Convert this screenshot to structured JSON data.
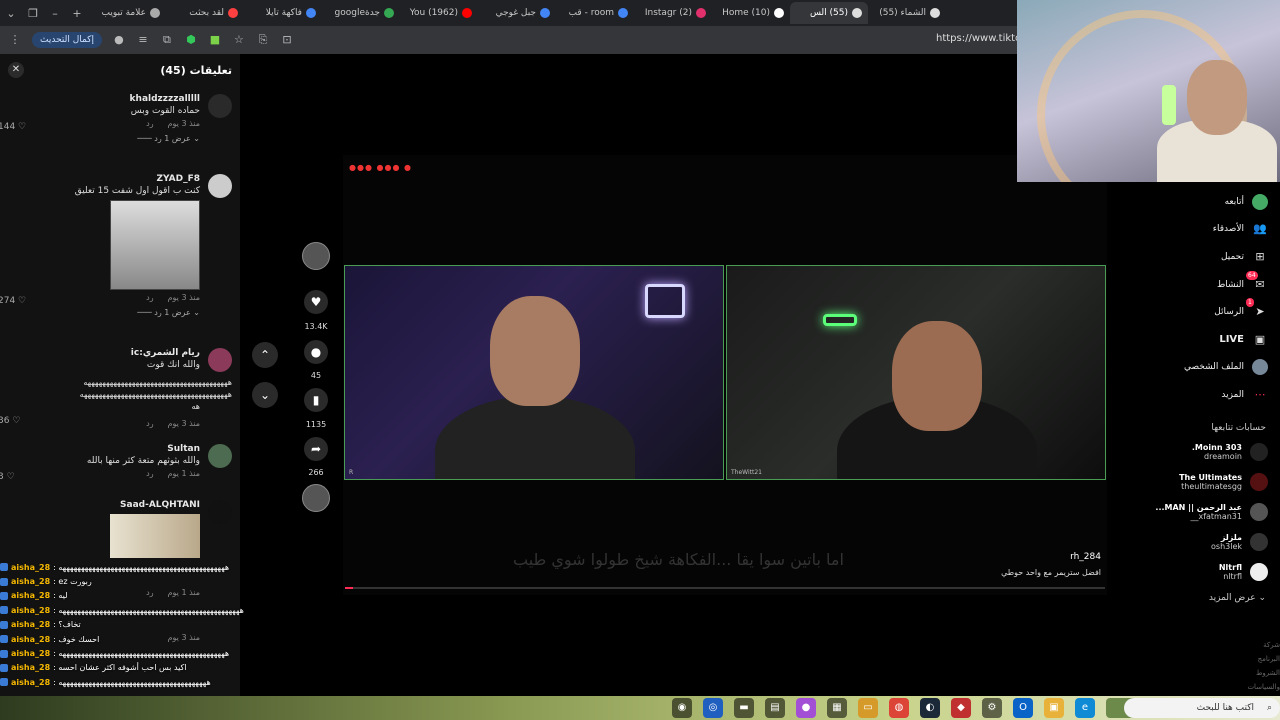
{
  "tabs": [
    {
      "label": "الشماء (55)",
      "color": "#ddd"
    },
    {
      "label": "(55) الس",
      "color": "#ddd",
      "active": true
    },
    {
      "label": "(10) Home",
      "color": "#fff"
    },
    {
      "label": "(2) Instagr",
      "color": "#e1306c"
    },
    {
      "label": "room - قب",
      "color": "#4285f4"
    },
    {
      "label": "جبل غوجي",
      "color": "#4285f4"
    },
    {
      "label": "(1962) You",
      "color": "#ff0000"
    },
    {
      "label": "جدةgoogle",
      "color": "#34a853"
    },
    {
      "label": "فاكهة تايلا",
      "color": "#4285f4"
    },
    {
      "label": "لقد بحثت",
      "color": "#ff4040"
    },
    {
      "label": "علامة تبويب",
      "color": "#aaa"
    }
  ],
  "toolbar": {
    "update_label": "إكمال التحديث",
    "url": "https://www.tiktok.co"
  },
  "comments": {
    "title": "تعليقات (45)",
    "items": [
      {
        "user": "khaldzzzzalllll",
        "text": "حماده القوت وبس",
        "time": "منذ 3 يوم",
        "reply": "رد",
        "likes": "144",
        "replies": "عرض 1 رد"
      },
      {
        "user": "ZYAD_F8",
        "text": "كنت ب اقول اول شفت 15 تعليق",
        "time": "منذ 3 يوم",
        "reply": "رد",
        "likes": "274",
        "replies": "عرض 1 رد"
      },
      {
        "user": "ريام الشمري:ic",
        "text": "والله انك قوت",
        "text2": "هههههههههههههههههههههههههههههههههههههههه",
        "text3": "ههههههههههههههههههههههههههههههههههههههههه",
        "text4": "هه",
        "time": "منذ 3 يوم",
        "reply": "رد",
        "likes": "36"
      },
      {
        "user": "Sultan",
        "text": "والله بثوثهم متعة كثر منها بالله",
        "time": "منذ 1 يوم",
        "reply": "رد",
        "likes": "3"
      },
      {
        "user": "Saad-ALQHTANI",
        "time": "منذ 1 يوم",
        "reply": "رد",
        "time2": "منذ 3 يوم"
      }
    ]
  },
  "chat": [
    {
      "user": "aisha_28",
      "msg": "هههههههههههههههههههههههههههههههههههههههههههههه"
    },
    {
      "user": "aisha_28",
      "msg": "ez ربورت"
    },
    {
      "user": "aisha_28",
      "msg": "ليه"
    },
    {
      "user": "aisha_28",
      "msg": "هههههههههههههههههههههههههههههههههههههههههههههههههه"
    },
    {
      "user": "aisha_28",
      "msg": "تخاف؟"
    },
    {
      "user": "aisha_28",
      "msg": "احسك خوف"
    },
    {
      "user": "aisha_28",
      "msg": "هههههههههههههههههههههههههههههههههههههههههههههه"
    },
    {
      "user": "aisha_28",
      "msg": "اكيد بس احب أشوفه اكثر عشان احسه"
    },
    {
      "user": "aisha_28",
      "msg": "ههههههههههههههههههههههههههههههههههههههههه"
    }
  ],
  "rail": {
    "likes": "13.4K",
    "comments": "45",
    "saves": "1135",
    "shares": "266"
  },
  "video": {
    "author": "rh_284",
    "caption": "افضل ستريمر مع واحد حوطي",
    "subtitle": "اما باتين سوا يقا ...الفكاهة شيخ طولوا شوي طيب",
    "left_tag": "R",
    "right_tag": "TheWitt21",
    "progress": 0.01
  },
  "rnav": {
    "items": [
      {
        "label": "أتابعه",
        "icon": "avatar"
      },
      {
        "label": "الأصدقاء",
        "icon": "👥"
      },
      {
        "label": "تحميل",
        "icon": "⊞"
      },
      {
        "label": "النشاط",
        "icon": "✉",
        "badge": "64"
      },
      {
        "label": "الرسائل",
        "icon": "➤",
        "badge": "1"
      },
      {
        "label": "LIVE",
        "icon": "▣"
      },
      {
        "label": "الملف الشخصي",
        "icon": "avatar"
      },
      {
        "label": "المزيد",
        "icon": "⋯"
      }
    ],
    "following_title": "حسابات تتابعها",
    "following": [
      {
        "name": "Moinn 303.",
        "handle": "dreamoin"
      },
      {
        "name": "The Ultimates",
        "handle": "theultimatesgg"
      },
      {
        "name": "عبد الرحمن || MAN...",
        "handle": "xfatman31__"
      },
      {
        "name": "ملزلز",
        "handle": "osh3lek"
      },
      {
        "name": "Nltrfl",
        "handle": "nltrfl"
      }
    ],
    "show_more": "عرض المزيد"
  },
  "footer": [
    "شركة",
    "البرنامج",
    "الشروط والسياسات"
  ],
  "taskbar": {
    "search_placeholder": "اكتب هنا للبحث"
  }
}
